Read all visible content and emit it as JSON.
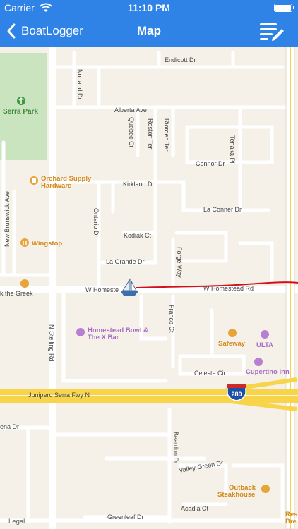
{
  "status_bar": {
    "carrier": "Carrier",
    "time": "11:10 PM"
  },
  "nav": {
    "back_label": "BoatLogger",
    "title": "Map"
  },
  "map": {
    "streets": {
      "endicott": "Endicott Dr",
      "norland": "Norland Dr",
      "alberta": "Alberta Ave",
      "quebec": "Quebec Ct",
      "reston": "Reston Ter",
      "riorden": "Riorden Ter",
      "tenaka": "Tenaka Pl",
      "connor": "Connor Dr",
      "kirkland": "Kirkland Dr",
      "laconner": "La Conner Dr",
      "brunswick": "New Brunswick Ave",
      "ontario": "Ontario Dr",
      "kodiak": "Kodiak Ct",
      "forge": "Forge Way",
      "lagrande": "La Grande Dr",
      "homestead_left": "W Homeste",
      "homestead_right": "W Homestead Rd",
      "greek": "k the Greek",
      "stelling": "N Stelling Rd",
      "francoct": "Franco Ct",
      "celeste": "Celeste Cir",
      "junipero": "Junipero Serra Fwy N",
      "ena": "ena Dr",
      "beardon": "Beardon Dr",
      "valleygreen": "Valley Green Dr",
      "acadia": "Acadia Ct",
      "greenleaf": "Greenleaf Dr",
      "interstate": "280"
    },
    "pois": {
      "serra_park": "Serra Park",
      "orchard_1": "Orchard Supply",
      "orchard_2": "Hardware",
      "wingstop": "Wingstop",
      "homestead_bowl_1": "Homestead Bowl &",
      "homestead_bowl_2": "The X Bar",
      "safeway": "Safeway",
      "ulta": "ULTA",
      "cupertino_inn": "Cupertino Inn",
      "outback_1": "Outback",
      "outback_2": "Steakhouse",
      "res_1": "Res",
      "res_2": "Bre"
    },
    "legal": "Legal",
    "track_color": "#d0111b",
    "colors": {
      "nav": "#2f83e6",
      "land": "#f5f1e8",
      "park": "#c9e4bf",
      "freeway": "#f7d44a",
      "poi_orange": "#e8a33a",
      "poi_purple": "#b77fd1"
    }
  }
}
